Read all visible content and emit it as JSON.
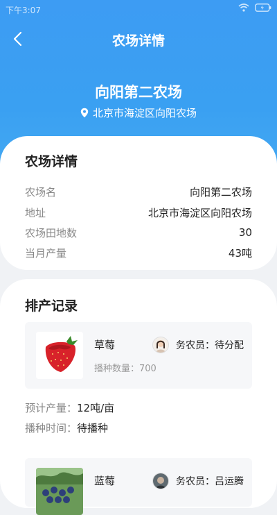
{
  "status": {
    "time": "下午3:07"
  },
  "nav": {
    "title": "农场详情"
  },
  "hero": {
    "farm_name": "向阳第二农场",
    "address": "北京市海淀区向阳农场"
  },
  "detail": {
    "title": "农场详情",
    "rows": [
      {
        "label": "农场名",
        "value": "向阳第二农场"
      },
      {
        "label": "地址",
        "value": "北京市海淀区向阳农场"
      },
      {
        "label": "农场田地数",
        "value": "30"
      },
      {
        "label": "当月产量",
        "value": "43吨"
      }
    ]
  },
  "production": {
    "title": "排产记录",
    "records": [
      {
        "crop": "草莓",
        "farmer": "务农员：待分配",
        "quantity": "播种数量：700",
        "expected_label": "预计产量：",
        "expected_value": "12吨/亩",
        "sow_time_label": "播种时间：",
        "sow_time_value": "待播种"
      },
      {
        "crop": "蓝莓",
        "farmer": "务农员：吕运腾"
      }
    ]
  },
  "colors": {
    "hero_blue": "#3d9cf3",
    "background": "#f0f2f5",
    "card": "#ffffff"
  },
  "icons": {
    "back": "chevron-left-icon",
    "location": "location-pin-icon",
    "wifi": "wifi-icon",
    "battery": "battery-icon"
  }
}
